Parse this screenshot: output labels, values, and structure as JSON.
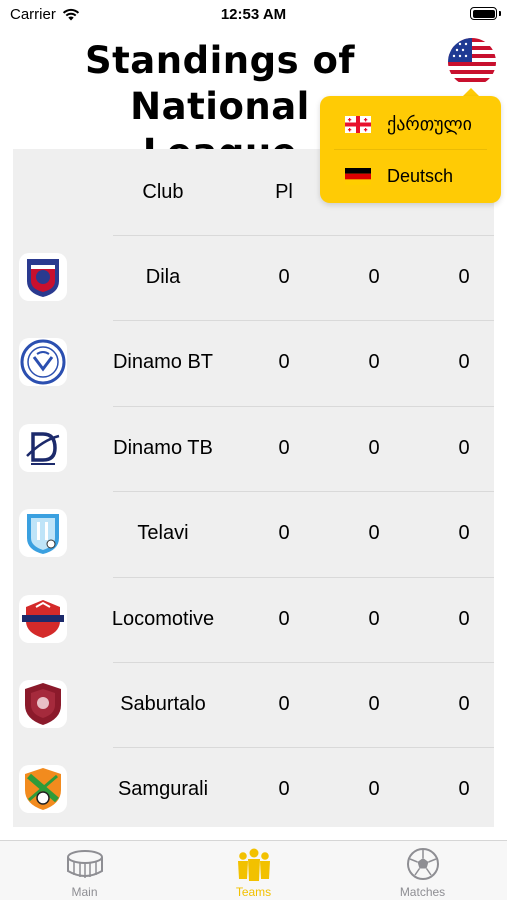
{
  "status_bar": {
    "carrier": "Carrier",
    "time": "12:53 AM"
  },
  "title": "Standings of\nNational League",
  "table": {
    "headers": {
      "club": "Club",
      "pl": "Pl"
    },
    "rows": [
      {
        "club": "Dila",
        "pl": "0",
        "c2": "0",
        "c3": "0"
      },
      {
        "club": "Dinamo BT",
        "pl": "0",
        "c2": "0",
        "c3": "0"
      },
      {
        "club": "Dinamo TB",
        "pl": "0",
        "c2": "0",
        "c3": "0"
      },
      {
        "club": "Telavi",
        "pl": "0",
        "c2": "0",
        "c3": "0"
      },
      {
        "club": "Locomotive",
        "pl": "0",
        "c2": "0",
        "c3": "0"
      },
      {
        "club": "Saburtalo",
        "pl": "0",
        "c2": "0",
        "c3": "0"
      },
      {
        "club": "Samgurali",
        "pl": "0",
        "c2": "0",
        "c3": "0"
      }
    ]
  },
  "language_menu": {
    "items": [
      {
        "label": "ქართული",
        "flag": "georgia-flag"
      },
      {
        "label": "Deutsch",
        "flag": "germany-flag"
      }
    ],
    "current_flag": "usa-flag"
  },
  "tab_bar": {
    "tabs": [
      {
        "label": "Main",
        "icon": "stadium-icon"
      },
      {
        "label": "Teams",
        "icon": "team-icon"
      },
      {
        "label": "Matches",
        "icon": "soccer-ball-icon"
      }
    ],
    "active": "Teams"
  },
  "colors": {
    "accent": "#ffcb05",
    "table_background": "#efefef",
    "tab_inactive": "#8e8e93"
  }
}
